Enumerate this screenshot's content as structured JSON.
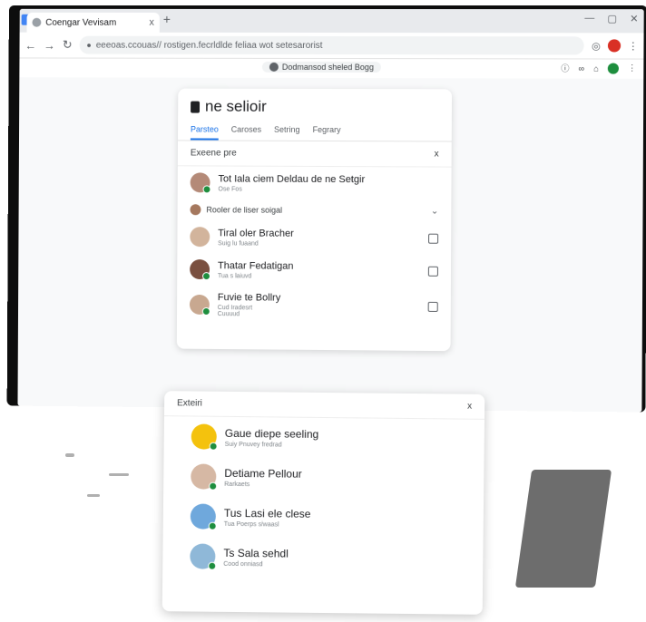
{
  "browser": {
    "tab_title": "Coengar Vevisam",
    "tab_close": "x",
    "new_tab": "+",
    "window_controls": [
      "—",
      "▢",
      "✕"
    ],
    "address": "eeeoas.ccouas// rostigen.fecrldlde feliaa wot setesarorist",
    "bookmark_pill": "Dodmansod sheled Bogg"
  },
  "card": {
    "title": "ne selioir",
    "tabs": [
      "Parsteo",
      "Caroses",
      "Setring",
      "Fegrary"
    ],
    "subheader": "Exeene pre",
    "close": "x",
    "first": {
      "name": "Tot Iala ciem Deldau de ne Setgir",
      "meta": "Ose Fos"
    },
    "group_label": "Rooler de liser soigal",
    "people": [
      {
        "name": "Tiral oler Bracher",
        "meta": "Suig lu fuaand"
      },
      {
        "name": "Thatar Fedatigan",
        "meta": "Tua s laiuvd"
      },
      {
        "name": "Fuvie te Bollry",
        "meta": "Cud Iradesrt\nCuuuud"
      }
    ]
  },
  "popup": {
    "header": "Exteiri",
    "close": "x",
    "people": [
      {
        "name": "Gaue diepe seeling",
        "meta": "Suiy Pnuvey fredrad"
      },
      {
        "name": "Detiame Pellour",
        "meta": "Rarkaets"
      },
      {
        "name": "Tus Lasi ele clese",
        "meta": "Tua Poerps siwaasl"
      },
      {
        "name": "Ts Sala sehdl",
        "meta": "Cood onniasd"
      }
    ]
  },
  "colors": {
    "accent": "#1a73e8",
    "online": "#1e8e3e",
    "avatar_yellow": "#f4c20d",
    "avatar_bg": "#c8b0a0"
  }
}
